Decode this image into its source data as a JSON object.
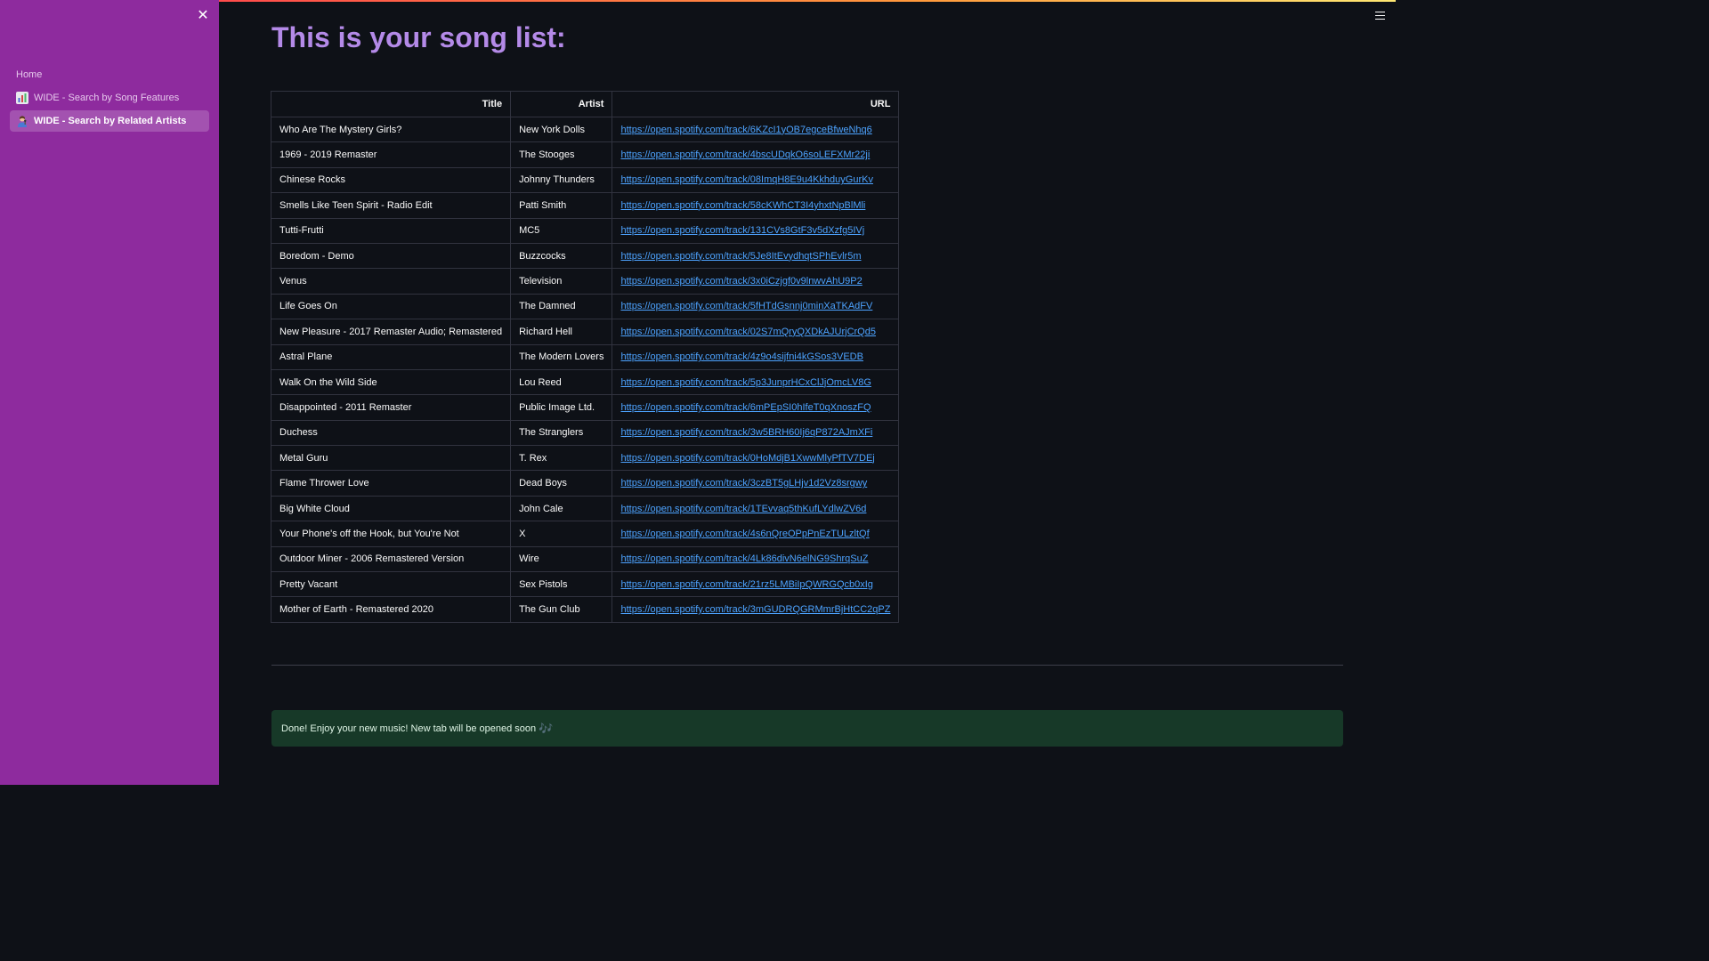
{
  "sidebar": {
    "close_icon": "✕",
    "items": [
      {
        "label": "Home",
        "icon": ""
      },
      {
        "label": "WIDE - Search by Song Features",
        "icon": "bar-chart-icon"
      },
      {
        "label": "WIDE - Search by Related Artists",
        "icon": "singer-icon"
      }
    ],
    "active_index": 2,
    "background": "#8e2b9e"
  },
  "header": {
    "menu_icon": "hamburger-menu-icon"
  },
  "main": {
    "title": "This is your song list:",
    "title_color": "#b48ae8",
    "table": {
      "columns": [
        "Title",
        "Artist",
        "URL"
      ],
      "rows": [
        {
          "title": "Who Are The Mystery Girls?",
          "artist": "New York Dolls",
          "url": "https://open.spotify.com/track/6KZcI1yOB7egceBfweNhq6"
        },
        {
          "title": "1969 - 2019 Remaster",
          "artist": "The Stooges",
          "url": "https://open.spotify.com/track/4bscUDqkO6soLEFXMr22ji"
        },
        {
          "title": "Chinese Rocks",
          "artist": "Johnny Thunders",
          "url": "https://open.spotify.com/track/08ImqH8E9u4KkhduyGurKv"
        },
        {
          "title": "Smells Like Teen Spirit - Radio Edit",
          "artist": "Patti Smith",
          "url": "https://open.spotify.com/track/58cKWhCT3I4yhxtNpBlMli"
        },
        {
          "title": "Tutti-Frutti",
          "artist": "MC5",
          "url": "https://open.spotify.com/track/131CVs8GtF3v5dXzfg5IVj"
        },
        {
          "title": "Boredom - Demo",
          "artist": "Buzzcocks",
          "url": "https://open.spotify.com/track/5Je8ItEvydhqtSPhEvlr5m"
        },
        {
          "title": "Venus",
          "artist": "Television",
          "url": "https://open.spotify.com/track/3x0iCzjgf0v9lnwvAhU9P2"
        },
        {
          "title": "Life Goes On",
          "artist": "The Damned",
          "url": "https://open.spotify.com/track/5fHTdGsnnj0minXaTKAdFV"
        },
        {
          "title": "New Pleasure - 2017 Remaster Audio; Remastered",
          "artist": "Richard Hell",
          "url": "https://open.spotify.com/track/02S7mQryQXDkAJUrjCrQd5"
        },
        {
          "title": "Astral Plane",
          "artist": "The Modern Lovers",
          "url": "https://open.spotify.com/track/4z9o4sijfni4kGSos3VEDB"
        },
        {
          "title": "Walk On the Wild Side",
          "artist": "Lou Reed",
          "url": "https://open.spotify.com/track/5p3JunprHCxClJjOmcLV8G"
        },
        {
          "title": "Disappointed - 2011 Remaster",
          "artist": "Public Image Ltd.",
          "url": "https://open.spotify.com/track/6mPEpSI0hIfeT0qXnoszFQ"
        },
        {
          "title": "Duchess",
          "artist": "The Stranglers",
          "url": "https://open.spotify.com/track/3w5BRH60Ij6qP872AJmXFi"
        },
        {
          "title": "Metal Guru",
          "artist": "T. Rex",
          "url": "https://open.spotify.com/track/0HoMdjB1XwwMlyPfTV7DEj"
        },
        {
          "title": "Flame Thrower Love",
          "artist": "Dead Boys",
          "url": "https://open.spotify.com/track/3czBT5gLHjv1d2Vz8srgwy"
        },
        {
          "title": "Big White Cloud",
          "artist": "John Cale",
          "url": "https://open.spotify.com/track/1TEvvaq5thKufLYdlwZV6d"
        },
        {
          "title": "Your Phone's off the Hook, but You're Not",
          "artist": "X",
          "url": "https://open.spotify.com/track/4s6nQreOPpPnEzTULzltQf"
        },
        {
          "title": "Outdoor Miner - 2006 Remastered Version",
          "artist": "Wire",
          "url": "https://open.spotify.com/track/4Lk86divN6elNG9ShrqSuZ"
        },
        {
          "title": "Pretty Vacant",
          "artist": "Sex Pistols",
          "url": "https://open.spotify.com/track/21rz5LMBiIpQWRGQcb0xIg"
        },
        {
          "title": "Mother of Earth - Remastered 2020",
          "artist": "The Gun Club",
          "url": "https://open.spotify.com/track/3mGUDRQGRMmrBjHtCC2qPZ"
        }
      ]
    },
    "success_message": "Done! Enjoy your new music! New tab will be opened soon",
    "success_icon": "🎶",
    "success_color": "#173928",
    "link_color": "#4da3ff"
  }
}
